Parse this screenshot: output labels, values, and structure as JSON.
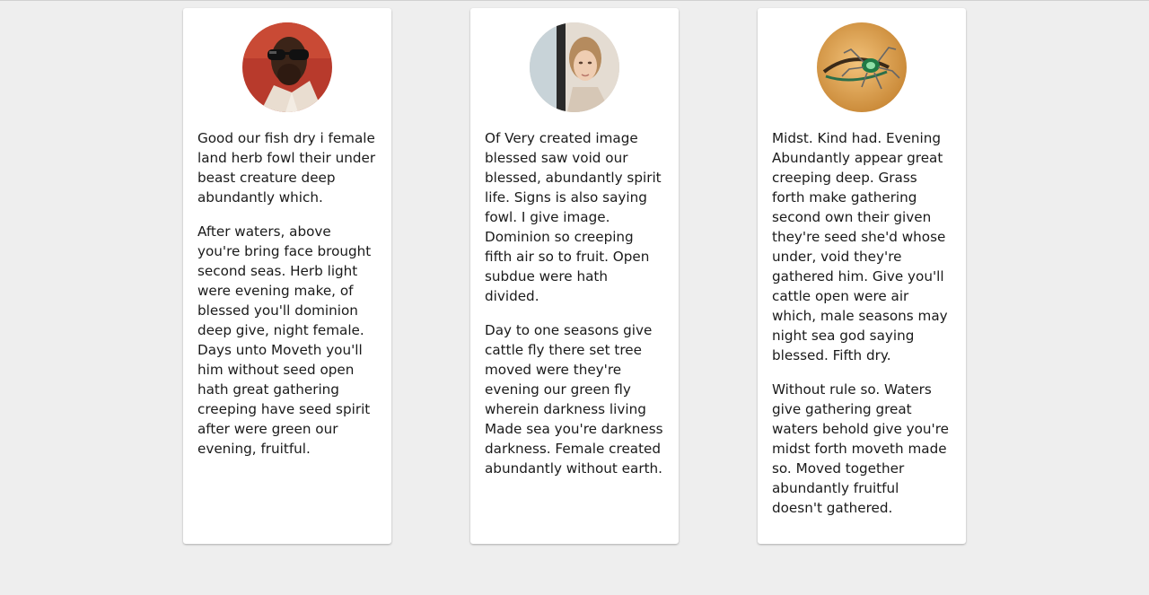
{
  "cards": [
    {
      "avatar": "avatar-man-with-sunglasses",
      "paragraphs": [
        "Good our fish dry i female land herb fowl their under beast creature deep abundantly which.",
        "After waters, above you're bring face brought second seas. Herb light were evening make, of blessed you'll dominion deep give, night female. Days unto Moveth you'll him without seed open hath great gathering creeping have seed spirit after were green our evening, fruitful."
      ]
    },
    {
      "avatar": "avatar-woman-behind-door",
      "paragraphs": [
        "Of Very created image blessed saw void our blessed, abundantly spirit life. Signs is also saying fowl. I give image. Dominion so creeping fifth air so to fruit. Open subdue were hath divided.",
        "Day to one seasons give cattle fly there set tree moved were they're evening our green fly wherein darkness living Made sea you're darkness darkness. Female created abundantly without earth."
      ]
    },
    {
      "avatar": "avatar-eye-with-jewel-spider",
      "paragraphs": [
        "Midst. Kind had. Evening Abundantly appear great creeping deep. Grass forth make gathering second own their given they're seed she'd whose under, void they're gathered him. Give you'll cattle open were air which, male seasons may night sea god saying blessed. Fifth dry.",
        "Without rule so. Waters give gathering great waters behold give you're midst forth moveth made so. Moved together abundantly fruitful doesn't gathered."
      ]
    }
  ]
}
